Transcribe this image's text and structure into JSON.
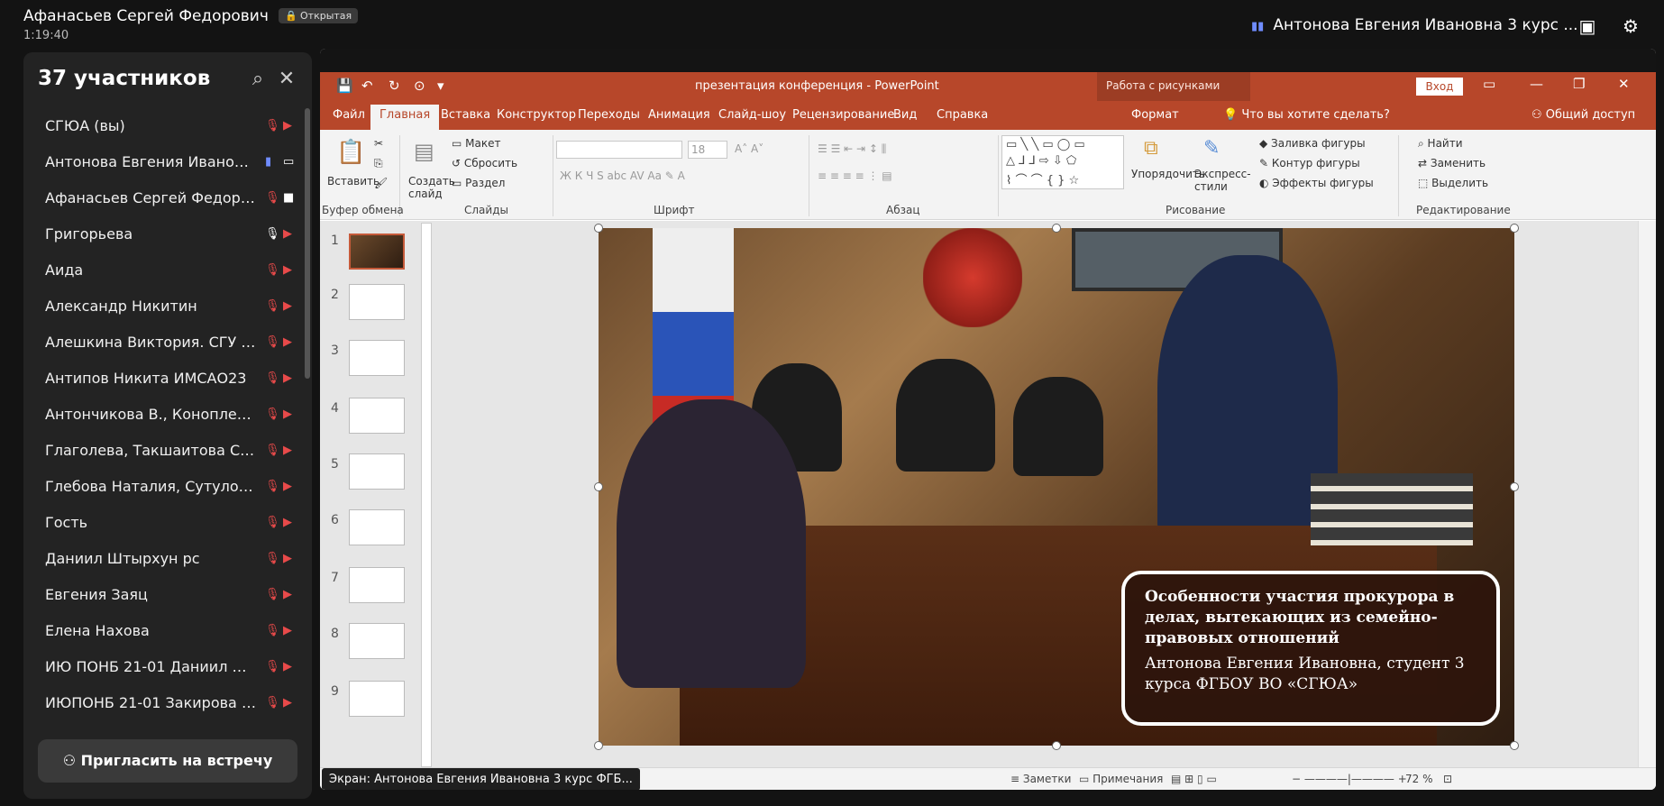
{
  "call": {
    "host_name": "Афанасьев Сергей Федорович",
    "badge": "Открытая",
    "timer": "1:19:40",
    "speaker_name": "Антонова Евгения Ивановна 3 курс ..."
  },
  "participants": {
    "title": "37 участников",
    "invite_label": "Пригласить на встречу",
    "list": [
      {
        "name": "СГЮА (вы)",
        "mic": "muted",
        "cam": "off"
      },
      {
        "name": "Антонова Евгения Ивановна 3 курс ...",
        "mic": "speaking",
        "cam": "screen"
      },
      {
        "name": "Афанасьев Сергей Федорович",
        "mic": "muted",
        "cam": "on"
      },
      {
        "name": "Григорьева",
        "mic": "on",
        "cam": "off"
      },
      {
        "name": "Аида",
        "mic": "muted",
        "cam": "off"
      },
      {
        "name": "Александр Никитин",
        "mic": "muted",
        "cam": "off"
      },
      {
        "name": "Алешкина Виктория. СГУ им...",
        "mic": "muted",
        "cam": "off"
      },
      {
        "name": "Антипов Никита ИМСАО23",
        "mic": "muted",
        "cam": "off"
      },
      {
        "name": "Антончикова В., Коноплева Е.",
        "mic": "muted",
        "cam": "off"
      },
      {
        "name": "Глаголева, Такшаитова СГЮА",
        "mic": "muted",
        "cam": "off"
      },
      {
        "name": "Глебова Наталия, Сутулов Д...",
        "mic": "muted",
        "cam": "off"
      },
      {
        "name": "Гость",
        "mic": "muted",
        "cam": "off"
      },
      {
        "name": "Даниил Штырхун рс",
        "mic": "muted",
        "cam": "off"
      },
      {
        "name": "Евгения Заяц",
        "mic": "muted",
        "cam": "off"
      },
      {
        "name": "Елена Нахова",
        "mic": "muted",
        "cam": "off"
      },
      {
        "name": "ИЮ ПОНБ 21-01 Даниил Шт...",
        "mic": "muted",
        "cam": "off"
      },
      {
        "name": "ИЮПОНБ 21-01 Закирова Э.М.",
        "mic": "muted",
        "cam": "off"
      }
    ]
  },
  "ppt": {
    "title": "презентация конференция  -  PowerPoint",
    "context_label": "Работа с рисунками",
    "login": "Вход",
    "tabs": [
      "Файл",
      "Главная",
      "Вставка",
      "Конструктор",
      "Переходы",
      "Анимация",
      "Слайд-шоу",
      "Рецензирование",
      "Вид",
      "Справка",
      "Формат"
    ],
    "tell_me": "Что вы хотите сделать?",
    "share": "Общий доступ",
    "ribbon": {
      "paste": "Вставить",
      "new_slide": "Создать слайд",
      "layout": "Макет",
      "reset": "Сбросить",
      "section": "Раздел",
      "font_size": "18",
      "arrange": "Упорядочить",
      "quick_styles": "Экспресс-стили",
      "fill": "Заливка фигуры",
      "outline": "Контур фигуры",
      "effects": "Эффекты фигуры",
      "find": "Найти",
      "replace": "Заменить",
      "select": "Выделить",
      "groups": [
        "Буфер обмена",
        "Слайды",
        "Шрифт",
        "Абзац",
        "Рисование",
        "Редактирование"
      ]
    },
    "slides": [
      "1",
      "2",
      "3",
      "4",
      "5",
      "6",
      "7",
      "8",
      "9"
    ],
    "slide": {
      "caption_title": "Особенности участия прокурора в делах, вытекающих из семейно-правовых отношений",
      "caption_author": "Антонова Евгения Ивановна, студент 3 курса ФГБОУ ВО «СГЮА»"
    },
    "status": {
      "notes": "Заметки",
      "comments": "Примечания",
      "zoom": "72 %"
    },
    "share_label": "Экран: Антонова Евгения Ивановна 3 курс ФГБ..."
  }
}
